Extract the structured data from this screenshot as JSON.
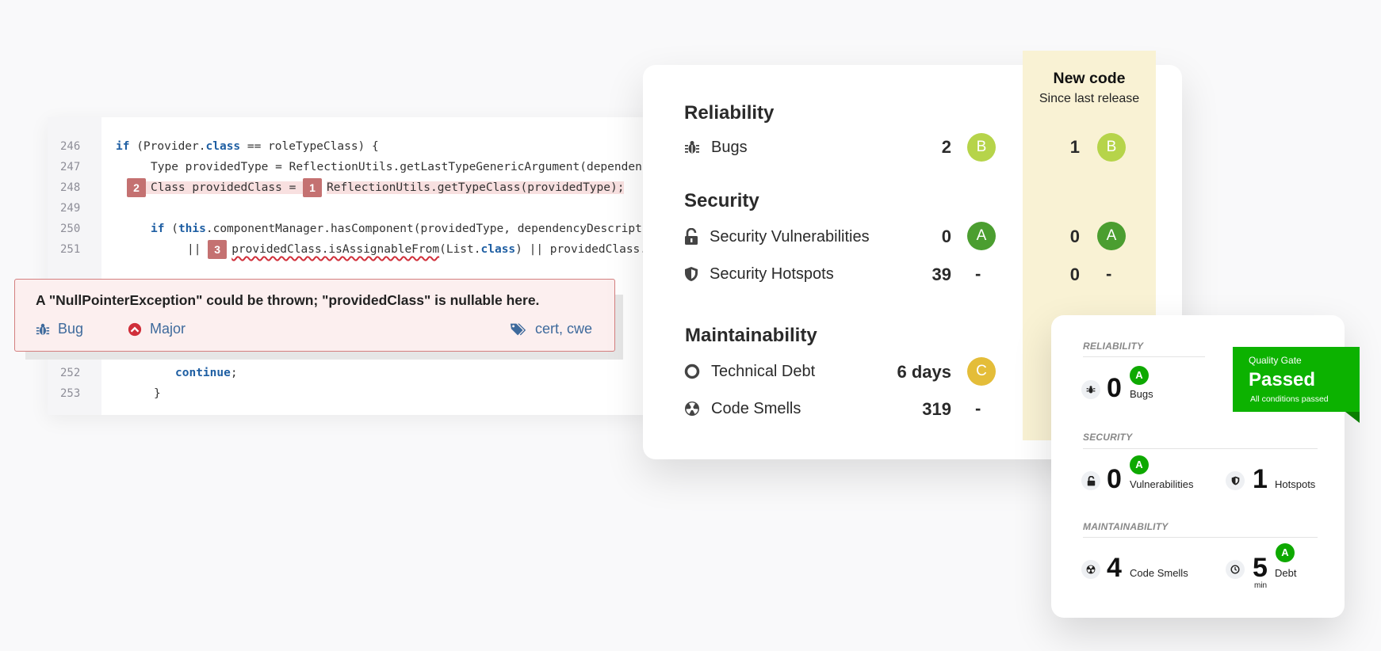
{
  "code": {
    "lines": [
      {
        "num": "246"
      },
      {
        "num": "247"
      },
      {
        "num": "248"
      },
      {
        "num": "249"
      },
      {
        "num": "250"
      },
      {
        "num": "251"
      },
      {
        "num": "252"
      },
      {
        "num": "253"
      }
    ],
    "l246": {
      "a": "if",
      "b": " (Provider.",
      "c": "class",
      "d": " == roleTypeClass) {"
    },
    "l247": {
      "a": "Type providedType = ReflectionUtils.getLastTypeGenericArgument(dependen"
    },
    "l248": {
      "step_a": "2",
      "a": "Class providedClass = ",
      "step_b": "1",
      "b": "ReflectionUtils.getTypeClass(providedType);"
    },
    "l250": {
      "a": "if",
      "b": " (",
      "c": "this",
      "d": ".componentManager.hasComponent(providedType, dependencyDescript"
    },
    "l251": {
      "a": "|| ",
      "step": "3",
      "b": "providedClass.isAssignableFrom",
      "c": "(List.",
      "d": "class",
      "e": ") || providedClass."
    },
    "l252": {
      "a": "continue",
      "b": ";"
    },
    "l253": {
      "a": "}"
    },
    "issue": {
      "message": "A \"NullPointerException\" could be thrown; \"providedClass\" is nullable here.",
      "type_label": "Bug",
      "severity_label": "Major",
      "tags_label": "cert, cwe",
      "icons": {
        "type": "bug-icon",
        "severity": "chevron-up-circle-icon",
        "tags": "tag-icon"
      }
    }
  },
  "ratings": {
    "new_code_title": "New code",
    "new_code_subtitle": "Since last release",
    "sections": {
      "reliability": "Reliability",
      "security": "Security",
      "maintainability": "Maintainability"
    },
    "rows": {
      "bugs": {
        "label": "Bugs",
        "value": "2",
        "grade": "B",
        "new_value": "1",
        "new_grade": "B"
      },
      "vulnerabilities": {
        "label": "Security Vulnerabilities",
        "value": "0",
        "grade": "A",
        "new_value": "0",
        "new_grade": "A"
      },
      "hotspots": {
        "label": "Security Hotspots",
        "value": "39",
        "grade": "-",
        "new_value": "0",
        "new_grade": "-"
      },
      "debt": {
        "label": "Technical Debt",
        "value": "6 days",
        "grade": "C"
      },
      "smells": {
        "label": "Code Smells",
        "value": "319",
        "grade": "-"
      }
    },
    "colors": {
      "grade_a": "#4b9e30",
      "grade_b": "#b6d44a",
      "grade_c": "#e4bd39",
      "new_code_bg": "#f9f2d4"
    }
  },
  "summary": {
    "reliability_heading": "RELIABILITY",
    "security_heading": "SECURITY",
    "maintainability_heading": "MAINTAINABILITY",
    "bugs": {
      "value": "0",
      "label": "Bugs",
      "grade": "A"
    },
    "vulnerabilities": {
      "value": "0",
      "label": "Vulnerabilities",
      "grade": "A"
    },
    "hotspots": {
      "value": "1",
      "label": "Hotspots"
    },
    "smells": {
      "value": "4",
      "label": "Code Smells"
    },
    "debt": {
      "value": "5",
      "unit": "min",
      "label": "Debt",
      "grade": "A"
    },
    "quality_gate": {
      "caption": "Quality Gate",
      "status": "Passed",
      "detail": "All conditions passed",
      "color": "#0cb200"
    }
  }
}
